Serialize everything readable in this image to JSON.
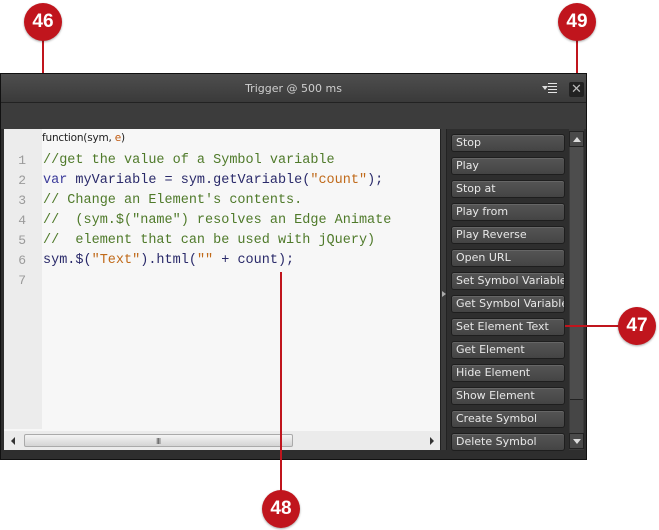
{
  "window": {
    "title": "Trigger @ 500 ms",
    "menu_icon": "panel-menu-icon",
    "close_icon": "close-icon",
    "close_glyph": "✕"
  },
  "editor": {
    "signature": {
      "prefix": "function(sym, ",
      "arg": "e",
      "suffix": ")"
    },
    "lines": [
      {
        "no": "1",
        "tokens": [
          {
            "t": "comment",
            "v": "//get the value of a Symbol variable"
          }
        ]
      },
      {
        "no": "2",
        "tokens": [
          {
            "t": "keyword",
            "v": "var"
          },
          {
            "t": "plain",
            "v": " myVariable = sym.getVariable("
          },
          {
            "t": "string",
            "v": "\"count\""
          },
          {
            "t": "plain",
            "v": ");"
          }
        ]
      },
      {
        "no": "3",
        "tokens": [
          {
            "t": "comment",
            "v": "// Change an Element's contents."
          }
        ]
      },
      {
        "no": "4",
        "tokens": [
          {
            "t": "comment",
            "v": "//  (sym.$(\"name\") resolves an Edge Animate"
          }
        ]
      },
      {
        "no": "5",
        "tokens": [
          {
            "t": "comment",
            "v": "//  element that can be used with jQuery)"
          }
        ]
      },
      {
        "no": "6",
        "tokens": [
          {
            "t": "plain",
            "v": "sym.$("
          },
          {
            "t": "string",
            "v": "\"Text\""
          },
          {
            "t": "plain",
            "v": ").html("
          },
          {
            "t": "string",
            "v": "\"\""
          },
          {
            "t": "plain",
            "v": " + count);"
          }
        ]
      },
      {
        "no": "7",
        "tokens": []
      }
    ],
    "hscroll_grip": "III"
  },
  "snippets": [
    "Stop",
    "Play",
    "Stop at",
    "Play from",
    "Play Reverse",
    "Open URL",
    "Set Symbol Variable",
    "Get Symbol Variable",
    "Set Element Text",
    "Get Element",
    "Hide Element",
    "Show Element",
    "Create Symbol",
    "Delete Symbol"
  ],
  "callouts": {
    "c46": "46",
    "c47": "47",
    "c48": "48",
    "c49": "49"
  },
  "colors": {
    "callout": "#c0151d",
    "comment": "#4f7a2a",
    "keyword": "#3a3a9a",
    "string": "#c06a1a"
  }
}
